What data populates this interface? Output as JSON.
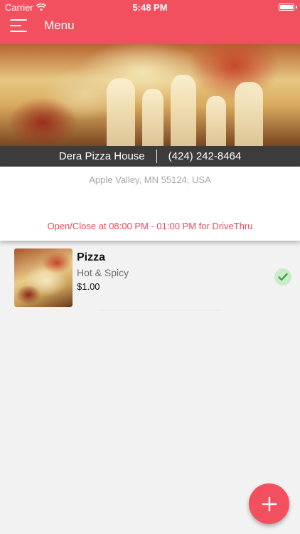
{
  "status_bar": {
    "carrier": "Carrier",
    "time": "5:48 PM",
    "battery_level": 1.0
  },
  "header": {
    "title": "Menu",
    "menu_icon": "hamburger-icon",
    "accent_color": "#f2505f"
  },
  "restaurant": {
    "name": "Dera Pizza House",
    "phone": "(424) 242-8464",
    "address": "Apple Valley, MN 55124, USA",
    "hours": "Open/Close at 08:00 PM - 01:00 PM for DriveThru",
    "hours_color": "#e84a55"
  },
  "menu_items": [
    {
      "name": "Pizza",
      "description": "Hot & Spicy",
      "price": "$1.00",
      "selected": true,
      "status_icon": "checkmark-icon"
    }
  ],
  "fab": {
    "icon": "plus-icon"
  }
}
